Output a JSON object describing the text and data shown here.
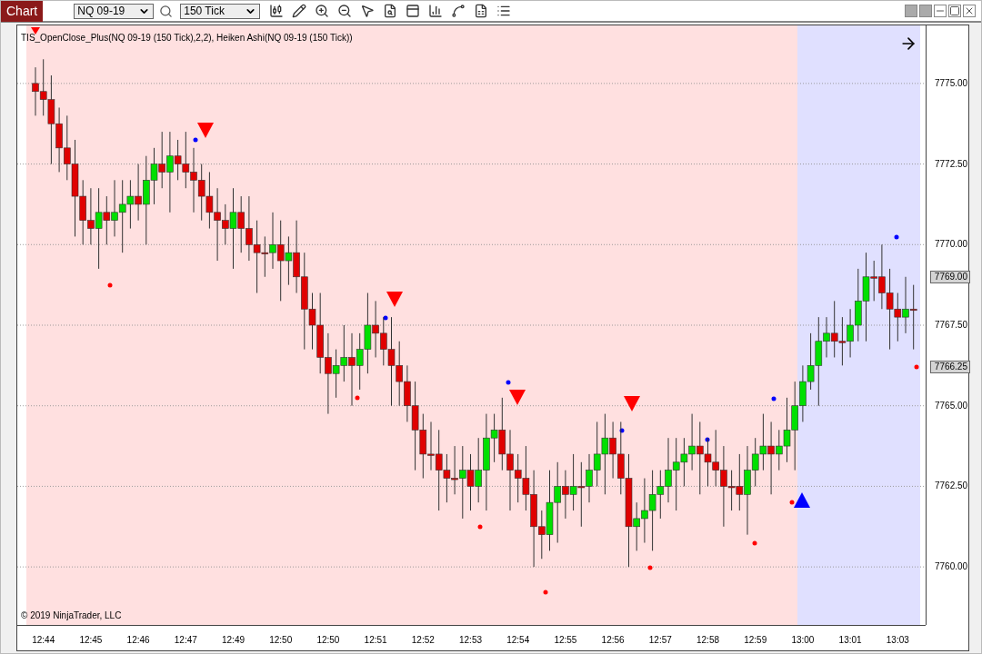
{
  "toolbar": {
    "title": "Chart",
    "instrument": "NQ 09-19",
    "interval": "150 Tick"
  },
  "chart": {
    "legend": "TIS_OpenClose_Plus(NQ 09-19 (150 Tick),2,2), Heiken Ashi(NQ 09-19 (150 Tick))",
    "copyright": "© 2019 NinjaTrader, LLC",
    "price_badges": [
      "7769.00",
      "7766.25"
    ],
    "time_labels": [
      "12:44",
      "12:45",
      "12:46",
      "12:47",
      "12:49",
      "12:50",
      "12:50",
      "12:51",
      "12:52",
      "12:53",
      "12:54",
      "12:55",
      "12:56",
      "12:57",
      "12:58",
      "12:59",
      "13:00",
      "13:01",
      "13:03"
    ],
    "chart_data": {
      "type": "candlestick",
      "ylim": [
        7758.2,
        7776.8
      ],
      "grid": true,
      "yticks": [
        {
          "value": 7775,
          "label": "7775.00"
        },
        {
          "value": 7772.5,
          "label": "7772.50"
        },
        {
          "value": 7770,
          "label": "7770.00"
        },
        {
          "value": 7767.5,
          "label": "7767.50"
        },
        {
          "value": 7765,
          "label": "7765.00"
        },
        {
          "value": 7762.5,
          "label": "7762.50"
        },
        {
          "value": 7760,
          "label": "7760.00"
        }
      ],
      "ohlc": [
        [
          7775,
          7775.5,
          7774,
          7774.75
        ],
        [
          7774.75,
          7775.75,
          7774,
          7774.5
        ],
        [
          7774.5,
          7775.25,
          7772.5,
          7773.75
        ],
        [
          7773.75,
          7774.25,
          7772.25,
          7773
        ],
        [
          7773,
          7774,
          7772,
          7772.5
        ],
        [
          7772.5,
          7773.25,
          7770.25,
          7771.5
        ],
        [
          7771.5,
          7772,
          7770,
          7770.75
        ],
        [
          7770.75,
          7771.75,
          7770,
          7770.5
        ],
        [
          7770.5,
          7771.75,
          7769.25,
          7771
        ],
        [
          7771,
          7771.5,
          7770,
          7770.75
        ],
        [
          7770.75,
          7772,
          7770.25,
          7771
        ],
        [
          7771,
          7772,
          7769.75,
          7771.25
        ],
        [
          7771.25,
          7772,
          7770.5,
          7771.5
        ],
        [
          7771.5,
          7772.5,
          7770.75,
          7771.25
        ],
        [
          7771.25,
          7772.75,
          7770,
          7772
        ],
        [
          7772,
          7773,
          7771.25,
          7772.5
        ],
        [
          7772.5,
          7773.5,
          7771.75,
          7772.25
        ],
        [
          7772.25,
          7773.5,
          7771,
          7772.75
        ],
        [
          7772.75,
          7773.25,
          7772,
          7772.5
        ],
        [
          7772.5,
          7773.5,
          7771.75,
          7772.25
        ],
        [
          7772.25,
          7773,
          7771,
          7772
        ],
        [
          7772,
          7772.5,
          7770.75,
          7771.5
        ],
        [
          7771.5,
          7772.25,
          7770.5,
          7771
        ],
        [
          7771,
          7771.75,
          7769.5,
          7770.75
        ],
        [
          7770.75,
          7771.25,
          7770,
          7770.5
        ],
        [
          7770.5,
          7771.75,
          7769.25,
          7771
        ],
        [
          7771,
          7771.5,
          7769.75,
          7770.5
        ],
        [
          7770.5,
          7771.5,
          7769.5,
          7770
        ],
        [
          7770,
          7770.75,
          7768.5,
          7769.75
        ],
        [
          7769.75,
          7770.25,
          7769,
          7769.75
        ],
        [
          7769.75,
          7771,
          7769.25,
          7770
        ],
        [
          7770,
          7770.75,
          7768.25,
          7769.5
        ],
        [
          7769.5,
          7770.25,
          7768.75,
          7769.75
        ],
        [
          7769.75,
          7770.75,
          7768.5,
          7769
        ],
        [
          7769,
          7769.75,
          7766.75,
          7768
        ],
        [
          7768,
          7768.5,
          7766.75,
          7767.5
        ],
        [
          7767.5,
          7768.5,
          7766,
          7766.5
        ],
        [
          7766.5,
          7767.25,
          7764.75,
          7766
        ],
        [
          7766,
          7766.75,
          7765.25,
          7766.25
        ],
        [
          7766.25,
          7767.5,
          7765.75,
          7766.5
        ],
        [
          7766.5,
          7767.25,
          7765,
          7766.25
        ],
        [
          7766.25,
          7767.25,
          7765.5,
          7766.75
        ],
        [
          7766.75,
          7768.5,
          7766,
          7767.5
        ],
        [
          7767.5,
          7768.25,
          7766.5,
          7767.25
        ],
        [
          7767.25,
          7767.75,
          7766.25,
          7766.75
        ],
        [
          7766.75,
          7767.75,
          7765,
          7766.25
        ],
        [
          7766.25,
          7767,
          7765,
          7765.75
        ],
        [
          7765.75,
          7766.25,
          7764.5,
          7765
        ],
        [
          7765,
          7765.75,
          7763,
          7764.25
        ],
        [
          7764.25,
          7764.75,
          7762.75,
          7763.5
        ],
        [
          7763.5,
          7764.5,
          7763,
          7763.5
        ],
        [
          7763.5,
          7764.25,
          7761.75,
          7763
        ],
        [
          7763,
          7763.5,
          7762,
          7762.75
        ],
        [
          7762.75,
          7763.75,
          7762.25,
          7762.75
        ],
        [
          7762.75,
          7763.75,
          7761.5,
          7763
        ],
        [
          7763,
          7763.5,
          7761.75,
          7762.5
        ],
        [
          7762.5,
          7764,
          7762,
          7763
        ],
        [
          7763,
          7764.75,
          7761.75,
          7764
        ],
        [
          7764,
          7764.75,
          7763.25,
          7764.25
        ],
        [
          7764.25,
          7765.25,
          7763,
          7763.5
        ],
        [
          7763.5,
          7764.25,
          7761.75,
          7763
        ],
        [
          7763,
          7763.5,
          7762,
          7762.75
        ],
        [
          7762.75,
          7763.75,
          7761.75,
          7762.25
        ],
        [
          7762.25,
          7763,
          7760,
          7761.25
        ],
        [
          7761.25,
          7761.75,
          7760.25,
          7761
        ],
        [
          7761,
          7763,
          7760.5,
          7762
        ],
        [
          7762,
          7763.25,
          7760.75,
          7762.5
        ],
        [
          7762.5,
          7763,
          7761.5,
          7762.25
        ],
        [
          7762.25,
          7763.5,
          7761.75,
          7762.5
        ],
        [
          7762.5,
          7763.25,
          7761.25,
          7762.5
        ],
        [
          7762.5,
          7763.5,
          7762,
          7763
        ],
        [
          7763,
          7764.5,
          7762.5,
          7763.5
        ],
        [
          7763.5,
          7764.75,
          7762.25,
          7764
        ],
        [
          7764,
          7764.5,
          7762.75,
          7763.5
        ],
        [
          7763.5,
          7764.5,
          7762.25,
          7762.75
        ],
        [
          7762.75,
          7763.5,
          7760,
          7761.25
        ],
        [
          7761.25,
          7762,
          7760.5,
          7761.5
        ],
        [
          7761.5,
          7762.75,
          7760.75,
          7761.75
        ],
        [
          7761.75,
          7763,
          7760.5,
          7762.25
        ],
        [
          7762.25,
          7763,
          7761.5,
          7762.5
        ],
        [
          7762.5,
          7764,
          7762,
          7763
        ],
        [
          7763,
          7764,
          7761.75,
          7763.25
        ],
        [
          7763.25,
          7764,
          7762.5,
          7763.5
        ],
        [
          7763.5,
          7764.75,
          7763,
          7763.75
        ],
        [
          7763.75,
          7764.5,
          7762.25,
          7763.5
        ],
        [
          7763.5,
          7764,
          7762.5,
          7763.25
        ],
        [
          7763.25,
          7764.25,
          7762.5,
          7763
        ],
        [
          7763,
          7763.75,
          7761.25,
          7762.5
        ],
        [
          7762.5,
          7763,
          7761.75,
          7762.5
        ],
        [
          7762.5,
          7763.5,
          7761.75,
          7762.25
        ],
        [
          7762.25,
          7763.75,
          7761,
          7763
        ],
        [
          7763,
          7764,
          7762.5,
          7763.5
        ],
        [
          7763.5,
          7764.75,
          7763,
          7763.75
        ],
        [
          7763.75,
          7764.5,
          7762.25,
          7763.5
        ],
        [
          7763.5,
          7764.25,
          7763,
          7763.75
        ],
        [
          7763.75,
          7765.25,
          7763.25,
          7764.25
        ],
        [
          7764.25,
          7765.75,
          7763,
          7765
        ],
        [
          7765,
          7766.25,
          7764.5,
          7765.75
        ],
        [
          7765.75,
          7767.25,
          7765.5,
          7766.25
        ],
        [
          7766.25,
          7767.75,
          7765,
          7767
        ],
        [
          7767,
          7767.75,
          7766.5,
          7767.25
        ],
        [
          7767.25,
          7768.25,
          7766.5,
          7767
        ],
        [
          7767,
          7767.75,
          7766.25,
          7767
        ],
        [
          7767,
          7768,
          7766.5,
          7767.5
        ],
        [
          7767.5,
          7769.25,
          7767,
          7768.25
        ],
        [
          7768.25,
          7769.75,
          7767,
          7769
        ],
        [
          7769,
          7769.5,
          7768.25,
          7769
        ],
        [
          7769,
          7770,
          7768,
          7768.5
        ],
        [
          7768.5,
          7769.25,
          7766.75,
          7768
        ],
        [
          7768,
          7768.5,
          7767,
          7767.75
        ],
        [
          7767.75,
          7769,
          7767.25,
          7768
        ],
        [
          7768,
          7768.75,
          7766.75,
          7768
        ]
      ]
    }
  }
}
